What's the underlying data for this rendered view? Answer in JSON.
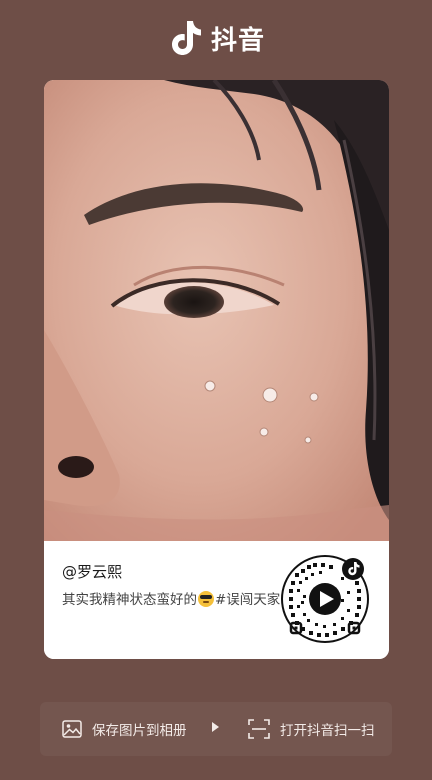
{
  "brand": {
    "name": "抖音",
    "logo_icon": "tiktok-note-icon"
  },
  "post": {
    "author": "@罗云熙",
    "description_before": "其实我精神状态蛮好的",
    "emoji": "sunglasses-emoji",
    "description_after": "#误闯天家",
    "qr_icon": "qr-code-icon",
    "play_icon": "play-icon"
  },
  "actions": {
    "save_label": "保存图片到相册",
    "save_icon": "image-icon",
    "separator_icon": "play-triangle-icon",
    "scan_label": "打开抖音扫一扫",
    "scan_icon": "scan-icon"
  },
  "colors": {
    "background": "#6e4e47",
    "bar": "#74564f",
    "card": "#ffffff"
  }
}
